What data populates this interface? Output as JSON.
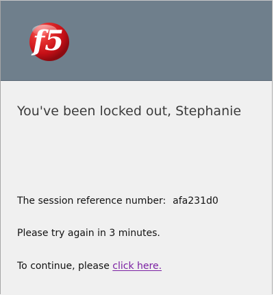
{
  "header": {
    "logo_icon": "f5-logo-icon",
    "logo_text": "f5",
    "background_color": "#6f7f8c"
  },
  "message": {
    "title": "You've been locked out, Stephanie",
    "session_label": "The session reference number:",
    "session_number": "afa231d0",
    "retry_text": "Please try again in 3 minutes.",
    "continue_prefix": "To continue, please",
    "continue_link": "click here."
  },
  "colors": {
    "content_background": "#f0f0f0",
    "link": "#7a1fa2",
    "logo_red": "#d71920"
  }
}
